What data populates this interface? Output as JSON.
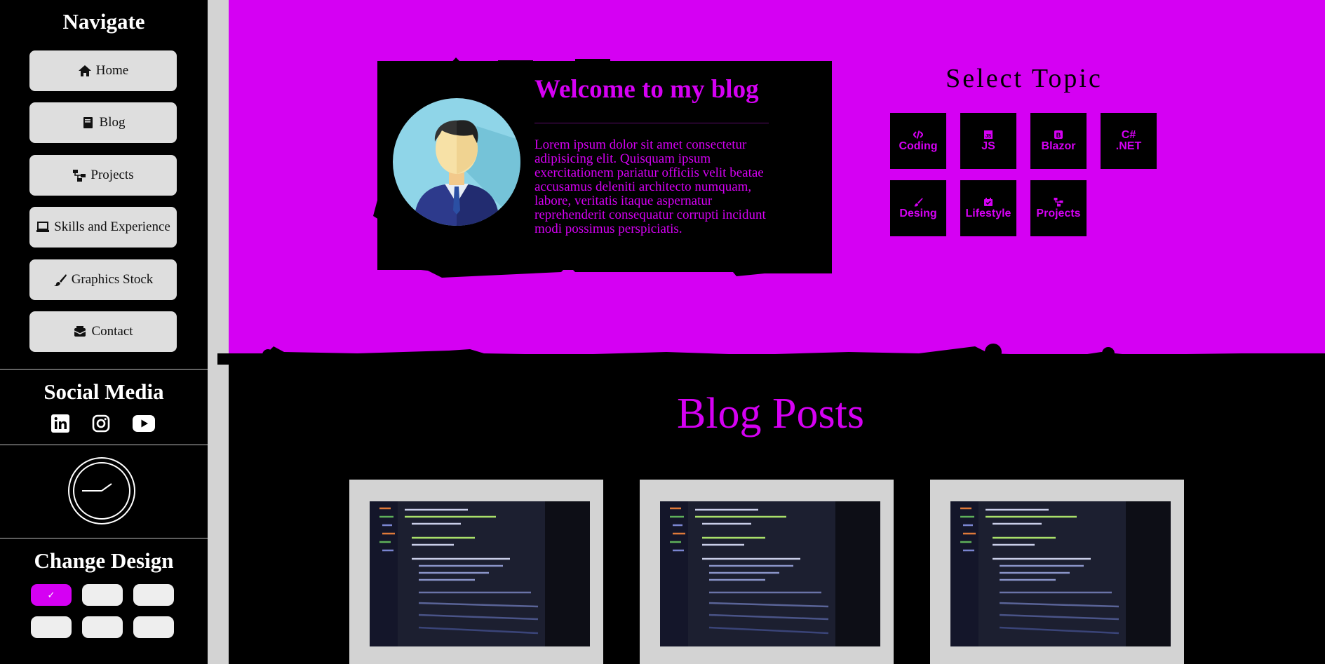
{
  "sidebar": {
    "nav_title": "Navigate",
    "nav_items": [
      {
        "label": "Home",
        "icon": "home-icon"
      },
      {
        "label": "Blog",
        "icon": "book-icon"
      },
      {
        "label": "Projects",
        "icon": "sitemap-icon"
      },
      {
        "label": "Skills and Experience",
        "icon": "laptop-icon"
      },
      {
        "label": "Graphics Stock",
        "icon": "brush-icon"
      },
      {
        "label": "Contact",
        "icon": "mailbox-icon"
      }
    ],
    "social_title": "Social Media",
    "social_icons": [
      "linkedin-icon",
      "instagram-icon",
      "youtube-icon"
    ],
    "design_title": "Change Design",
    "design_selected_mark": "✓",
    "swatch_colors": [
      "#d500f3",
      "#eeeeee",
      "#eeeeee",
      "#eeeeee",
      "#eeeeee",
      "#eeeeee"
    ]
  },
  "hero": {
    "welcome_title": "Welcome to my blog",
    "welcome_text": "Lorem ipsum dolor sit amet consectetur adipisicing elit. Quisquam ipsum exercitationem pariatur officiis velit beatae accusamus deleniti architecto numquam, labore, veritatis itaque aspernatur reprehenderit consequatur corrupti incidunt modi possimus perspiciatis.",
    "topic_title": "Select Topic",
    "topics": [
      {
        "label": "Coding",
        "icon": "code-icon"
      },
      {
        "label": "JS",
        "icon": "js-icon"
      },
      {
        "label": "Blazor",
        "icon": "blazor-icon"
      },
      {
        "label_line1": "C#",
        "label_line2": ".NET"
      },
      {
        "label": "Desing",
        "icon": "brush-icon"
      },
      {
        "label": "Lifestyle",
        "icon": "calendar-icon"
      },
      {
        "label": "Projects",
        "icon": "sitemap-icon"
      }
    ]
  },
  "blog": {
    "title": "Blog Posts"
  },
  "colors": {
    "accent": "#d500f3",
    "background": "#000000",
    "card_frame": "#d3d3d3",
    "button": "#dedede"
  }
}
